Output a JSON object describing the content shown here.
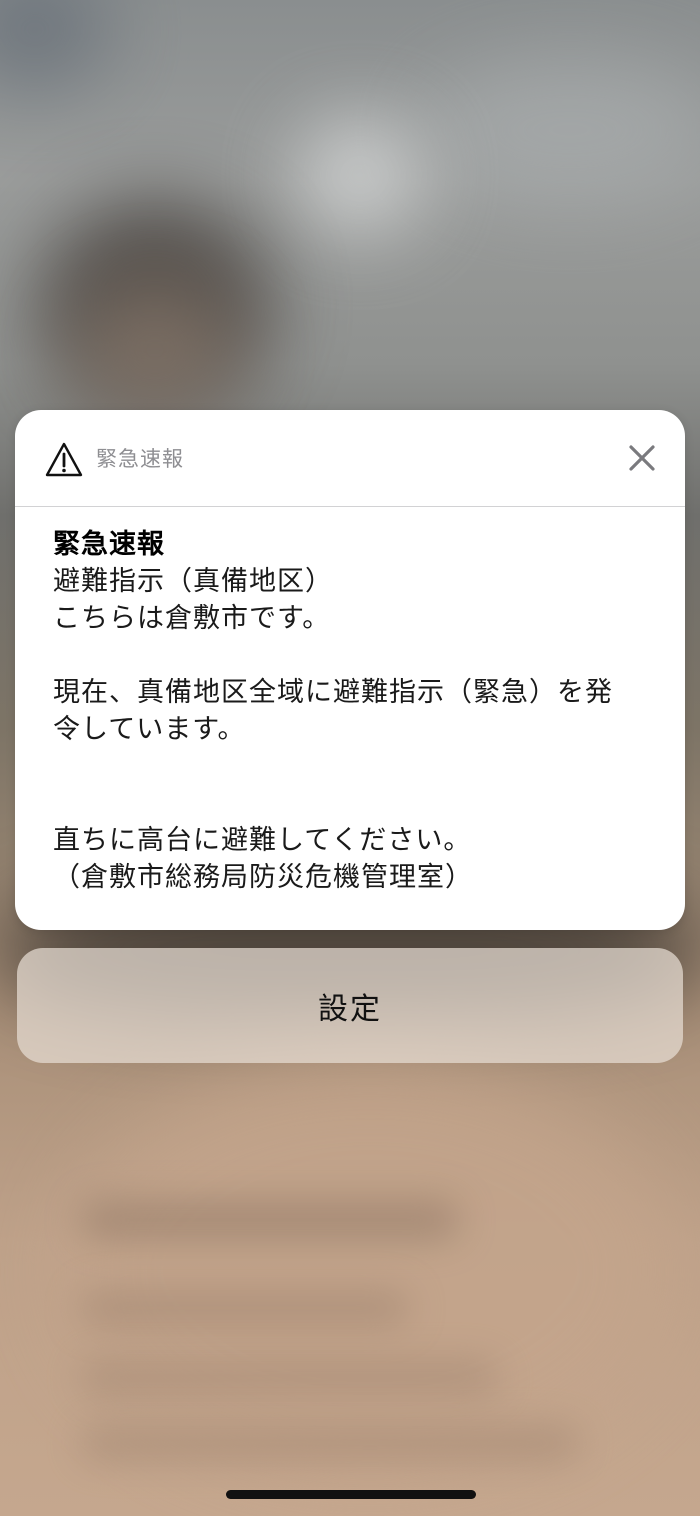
{
  "alert": {
    "app_name": "緊急速報",
    "title": "緊急速報",
    "message": "避難指示（真備地区）\nこちらは倉敷市です。\n\n現在、真備地区全域に避難指示（緊急）を発\n令しています。\n\n\n直ちに高台に避難してください。\n（倉敷市総務局防災危機管理室）",
    "header_icon": "warning-triangle-icon",
    "close_icon": "close-icon"
  },
  "settings_button": {
    "label": "設定"
  },
  "colors": {
    "card_background": "#ffffff",
    "secondary_text": "#8e8e92",
    "divider": "#d2d2d4",
    "close_icon": "#7a7a7e"
  }
}
